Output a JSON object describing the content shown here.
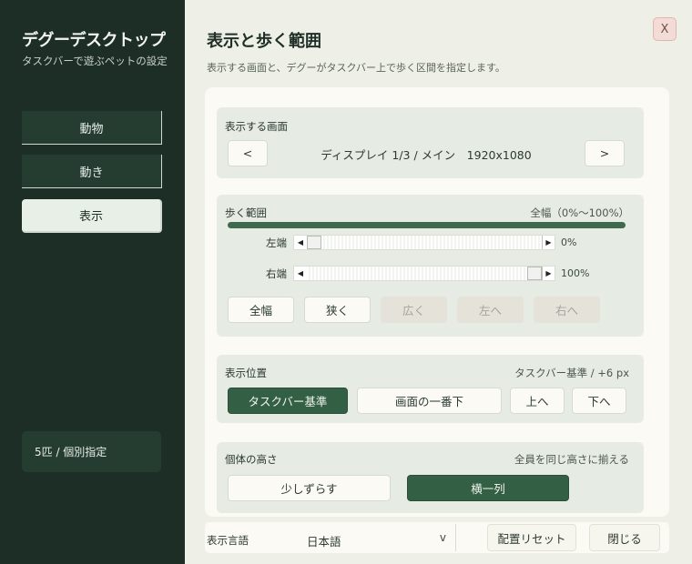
{
  "sidebar": {
    "app_title": "デグーデスクトップ",
    "app_subtitle": "タスクバーで遊ぶペットの設定",
    "nav": [
      {
        "label": "動物"
      },
      {
        "label": "動き"
      },
      {
        "label": "表示",
        "active": true
      }
    ],
    "status": "5匹 / 個別指定"
  },
  "header": {
    "title": "表示と歩く範囲",
    "description": "表示する画面と、デグーがタスクバー上で歩く区間を指定します。",
    "close_label": "X"
  },
  "display_section": {
    "label": "表示する画面",
    "prev_label": "<",
    "next_label": ">",
    "current": "ディスプレイ 1/3 / メイン　1920x1080"
  },
  "range_section": {
    "label": "歩く範囲",
    "summary": "全幅（0%〜100%）",
    "range_start_pct": 0,
    "range_end_pct": 100,
    "left": {
      "label": "左端",
      "value": "0%",
      "position": 0
    },
    "right": {
      "label": "右端",
      "value": "100%",
      "position": 1
    },
    "buttons": [
      {
        "label": "全幅",
        "enabled": true
      },
      {
        "label": "狭く",
        "enabled": true
      },
      {
        "label": "広く",
        "enabled": false
      },
      {
        "label": "左へ",
        "enabled": false
      },
      {
        "label": "右へ",
        "enabled": false
      }
    ]
  },
  "position_section": {
    "label": "表示位置",
    "summary": "タスクバー基準 / +6 px",
    "buttons": [
      {
        "label": "タスクバー基準",
        "selected": true
      },
      {
        "label": "画面の一番下",
        "selected": false
      },
      {
        "label": "上へ",
        "selected": false
      },
      {
        "label": "下へ",
        "selected": false
      }
    ]
  },
  "height_section": {
    "label": "個体の高さ",
    "summary": "全員を同じ高さに揃える",
    "buttons": [
      {
        "label": "少しずらす",
        "selected": false
      },
      {
        "label": "横一列",
        "selected": true
      }
    ]
  },
  "footer": {
    "language_label": "表示言語",
    "language_value": "日本語",
    "chevron": "v",
    "reset_label": "配置リセット",
    "close_label": "閉じる"
  },
  "colors": {
    "sidebar_bg": "#1c2e25",
    "accent": "#336044",
    "panel_bg": "#eeefe6",
    "section_bg": "#e6ebe3"
  }
}
